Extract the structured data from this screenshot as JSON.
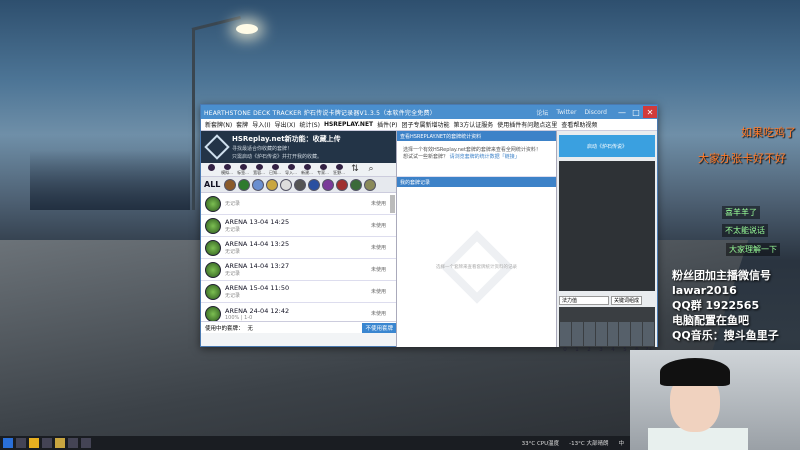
{
  "window": {
    "title": "HEARTHSTONE DECK TRACKER 炉石传说卡牌记录器V1.3.5（本软件完全免费）",
    "title_links": [
      "论坛",
      "Twitter",
      "Discord"
    ],
    "controls": [
      "—",
      "□",
      "✕"
    ]
  },
  "menu": [
    "新套牌(N)",
    "套牌",
    "导入(I)",
    "导出(X)",
    "统计(S)",
    "HSREPLAY.NET",
    "插件(P)",
    "团子专属新增功能",
    "第3方认证服务",
    "使用插件有问题点这里",
    "查看帮助视频"
  ],
  "hsreplay": {
    "title": "HSReplay.net新功能：收藏上传",
    "line1": "寻找最适合你收藏的套牌！",
    "line2": "只需启动《炉石传说》并打开我的收藏。"
  },
  "filters": [
    "",
    "模拟...",
    "标签...",
    "宽容...",
    "已知...",
    "导入...",
    "新建...",
    "专家...",
    "狂野..."
  ],
  "class_all": "ALL",
  "decks": [
    {
      "name": "",
      "sub": "无记录",
      "status": "未使用"
    },
    {
      "name": "ARENA 13-04 14:25",
      "sub": "无记录",
      "status": "未使用"
    },
    {
      "name": "ARENA 14-04 13:25",
      "sub": "无记录",
      "status": "未使用"
    },
    {
      "name": "ARENA 14-04 13:27",
      "sub": "无记录",
      "status": "未使用"
    },
    {
      "name": "ARENA 15-04 11:50",
      "sub": "无记录",
      "status": "未使用"
    },
    {
      "name": "ARENA 24-04 12:42",
      "sub": "100% | 1-0",
      "status": "未使用"
    }
  ],
  "in_use": {
    "label": "使用中的套牌：",
    "value": "无",
    "button": "不使用套牌"
  },
  "mid": {
    "header": "查看HSREPLAY.NET的套牌统计资料",
    "line1": "选择一个有效HSReplay.net套牌的套牌来查看全网统计资料！",
    "line2": "想试试一些新套牌？",
    "link": "请浏览套牌的统计数据「链接」",
    "panel2": "我的套牌记录",
    "empty": "选择一个套牌来查看套牌统计资料的记录"
  },
  "right": {
    "launch": "启动《炉石传说》",
    "filter_label": "法力值",
    "filter_btn": "关键词组成",
    "costs": [
      "0",
      "1",
      "2",
      "3",
      "4",
      "5",
      "6",
      "7+"
    ]
  },
  "overlay": {
    "red1": "如果吃鸡了",
    "red2": "大家办张卡好不好",
    "chat": [
      "喜羊羊了",
      "不太能说话",
      "大家理解一下"
    ],
    "info": [
      "粉丝团加主播微信号",
      "lawar2016",
      "QQ群 1922565",
      "电脑配置在鱼吧",
      "QQ音乐：搜斗鱼里子"
    ]
  },
  "taskbar": {
    "temp": "33°C",
    "cpu": "CPU温度",
    "weather": "-13°C",
    "wind": "大部晴朗",
    "ime": "中"
  },
  "colors": {
    "titlebar": "#4a8fce",
    "accent": "#3d82c8",
    "overlay_red": "#ff7a2a",
    "overlay_chat": "#99ff99"
  }
}
